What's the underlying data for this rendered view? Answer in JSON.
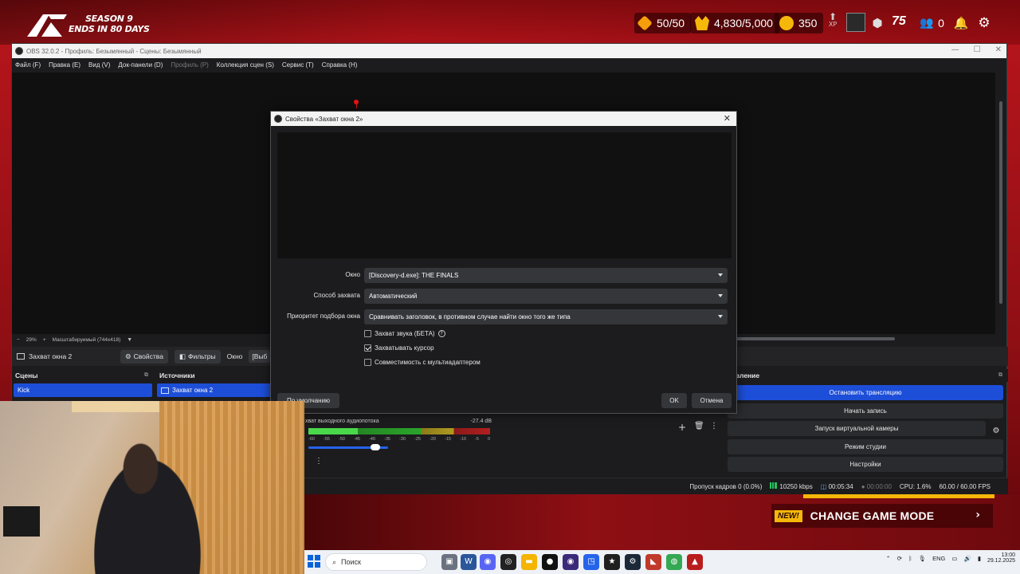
{
  "hud": {
    "season_line1": "SEASON 9",
    "season_line2": "ENDS IN 80 DAYS",
    "stat1": "50/50",
    "stat2": "4,830/5,000",
    "stat3": "350",
    "level": "75",
    "friends_count": "0",
    "xp_label": "XP",
    "icons": [
      "logo-icon",
      "gems-icon",
      "crown-icon",
      "coin-icon",
      "xp-icon",
      "avatar",
      "rank-icon",
      "friends-icon",
      "bell-icon",
      "gear-icon"
    ],
    "colors": {
      "accent": "#f5b70a",
      "red": "#b3151b"
    }
  },
  "obs": {
    "title": "OBS 32.0.2 - Профиль: Безымянный - Сцены: Безымянный",
    "menu": [
      "Файл (F)",
      "Правка (E)",
      "Вид (V)",
      "Док-панели (D)",
      "Профиль (P)",
      "Коллекция сцен (S)",
      "Сервис (T)",
      "Справка (H)"
    ],
    "zoom": {
      "minus": "−",
      "percent": "29%",
      "plus": "+",
      "scale_mode": "Масштабируемый (744x418)"
    },
    "toolbar": {
      "source_name": "Захват окна 2",
      "properties": "Свойства",
      "filters": "Фильтры",
      "window_label": "Окно",
      "window_value": "[Выб"
    },
    "docks": {
      "scenes": "Сцены",
      "sources": "Источники",
      "controls": "равление"
    },
    "scenes": [
      "Kick"
    ],
    "sources": [
      "Захват окна 2"
    ],
    "controls": {
      "stop_stream": "Остановить трансляцию",
      "start_record": "Начать запись",
      "virtual_cam": "Запуск виртуальной камеры",
      "studio_mode": "Режим студии",
      "settings": "Настройки"
    },
    "mixer": {
      "name": "хват выходного аудиопотока",
      "db": "-27.4 dB",
      "level": 0.27,
      "volume": 0.9,
      "scale": [
        "-60",
        "-55",
        "-50",
        "-45",
        "-40",
        "-35",
        "-30",
        "-25",
        "-20",
        "-15",
        "-10",
        "-5",
        "0"
      ]
    },
    "status": {
      "dropped": "Пропуск кадров 0 (0.0%)",
      "bitrate": "10250 kbps",
      "stream_time": "00:05:34",
      "rec_time": "00:00:00",
      "cpu": "CPU: 1.6%",
      "fps": "60.00 / 60.00 FPS"
    }
  },
  "dialog": {
    "title": "Свойства «Захват окна 2»",
    "window_label": "Окно",
    "window_value": "[Discovery-d.exe]: THE FINALS",
    "method_label": "Способ захвата",
    "method_value": "Автоматический",
    "priority_label": "Приоритет подбора окна",
    "priority_value": "Сравнивать заголовок, в противном случае найти окно того же типа",
    "chk_audio": "Захват звука (БЕТА)",
    "chk_audio_on": false,
    "chk_cursor": "Захватывать курсор",
    "chk_cursor_on": true,
    "chk_multi": "Совместимость с мультиадаптером",
    "chk_multi_on": false,
    "defaults": "По умолчанию",
    "ok": "OK",
    "cancel": "Отмена"
  },
  "game": {
    "new_badge": "NEW!",
    "change_mode": "CHANGE GAME MODE"
  },
  "taskbar": {
    "search": "Поиск",
    "lang": "ENG",
    "time": "13:00",
    "date": "29.12.2025"
  }
}
